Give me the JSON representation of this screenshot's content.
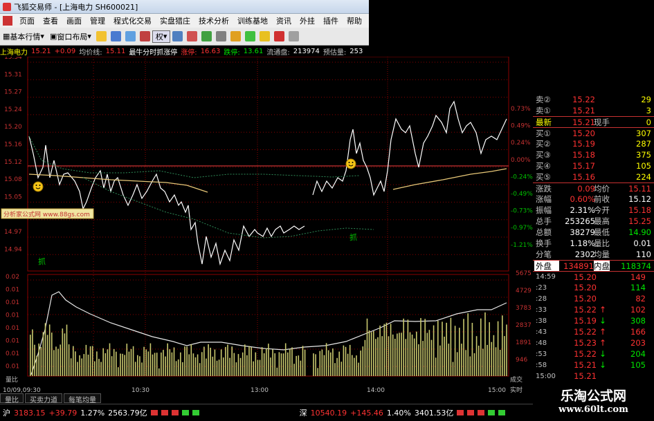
{
  "window": {
    "title": "飞狐交易师 - [上海电力 SH600021]"
  },
  "menu": [
    "页面",
    "查看",
    "画面",
    "管理",
    "程式化交易",
    "实盘猎庄",
    "技术分析",
    "训练基地",
    "资讯",
    "外挂",
    "插件",
    "帮助"
  ],
  "toolbar": {
    "basic": "基本行情",
    "layout": "窗口布局",
    "rights": "权"
  },
  "info": {
    "name": "上海电力",
    "price": "15.21",
    "change": "+0.09",
    "avg_label": "均价线:",
    "avg": "15.11",
    "indicator": "最牛分时抓涨停",
    "zt_label": "涨停:",
    "zt": "16.63",
    "dt_label": "跌停:",
    "dt": "13.61",
    "float_label": "流通盘:",
    "float": "213974",
    "est_label": "预估量:",
    "est": "253"
  },
  "axis": {
    "price_ticks": [
      "15.34",
      "15.31",
      "15.27",
      "15.24",
      "15.20",
      "15.16",
      "15.12",
      "15.08",
      "15.05",
      "15.01",
      "14.97",
      "14.94"
    ],
    "pct_ticks": [
      "0.73%",
      "0.49%",
      "0.24%",
      "0.00%",
      "-0.24%",
      "-0.49%",
      "-0.73%",
      "-0.97%",
      "-1.21%"
    ],
    "vol_left": [
      "0.02",
      "0.01",
      "0.01",
      "0.01",
      "0.01",
      "0.01",
      "0.01",
      "0.01"
    ],
    "vol_right": [
      "5675",
      "4729",
      "3783",
      "2837",
      "1891",
      "946"
    ],
    "time_ticks": [
      "10/09,09:30",
      "10:30",
      "13:00",
      "14:00",
      "15:00"
    ],
    "vol_label": "量比",
    "turnover_label": "成交",
    "fixed_label": "实时"
  },
  "annotations": {
    "site_label": "分析家公式网 www.88gs.com",
    "zhua1": "抓",
    "zhua2": "抓"
  },
  "quote": {
    "sells": [
      {
        "label": "卖②",
        "price": "15.22",
        "vol": "29"
      },
      {
        "label": "卖①",
        "price": "15.21",
        "vol": "3"
      }
    ],
    "last": {
      "label": "最新",
      "price": "15.21",
      "label2": "现手",
      "vol": "0"
    },
    "buys": [
      {
        "label": "买①",
        "price": "15.20",
        "vol": "307"
      },
      {
        "label": "买②",
        "price": "15.19",
        "vol": "287"
      },
      {
        "label": "买③",
        "price": "15.18",
        "vol": "375"
      },
      {
        "label": "买④",
        "price": "15.17",
        "vol": "105"
      },
      {
        "label": "买⑤",
        "price": "15.16",
        "vol": "224"
      }
    ],
    "stats": [
      {
        "l1": "涨跌",
        "v1": "0.09",
        "c1": "red",
        "l2": "均价",
        "v2": "15.11",
        "c2": "red"
      },
      {
        "l1": "涨幅",
        "v1": "0.60%",
        "c1": "red",
        "l2": "前收",
        "v2": "15.12",
        "c2": "white"
      },
      {
        "l1": "振幅",
        "v1": "2.31%",
        "c1": "white",
        "l2": "今开",
        "v2": "15.18",
        "c2": "red"
      },
      {
        "l1": "总手",
        "v1": "253265",
        "c1": "white",
        "l2": "最高",
        "v2": "15.25",
        "c2": "red"
      },
      {
        "l1": "总额",
        "v1": "38279",
        "c1": "white",
        "l2": "最低",
        "v2": "14.90",
        "c2": "green"
      },
      {
        "l1": "换手",
        "v1": "1.18%",
        "c1": "white",
        "l2": "量比",
        "v2": "0.01",
        "c2": "white"
      },
      {
        "l1": "分笔",
        "v1": "2302",
        "c1": "white",
        "l2": "均量",
        "v2": "110",
        "c2": "white"
      }
    ],
    "outer": {
      "l1": "外盘",
      "v1": "134891",
      "l2": "内盘",
      "v2": "118374"
    }
  },
  "ticks": [
    {
      "t": "14:59",
      "p": "15.20",
      "dir": "",
      "v": "149",
      "pc": "red",
      "vc": "red"
    },
    {
      "t": ":23",
      "p": "15.20",
      "dir": "",
      "v": "114",
      "pc": "red",
      "vc": "green"
    },
    {
      "t": ":28",
      "p": "15.20",
      "dir": "",
      "v": "82",
      "pc": "red",
      "vc": "red"
    },
    {
      "t": ":33",
      "p": "15.22",
      "dir": "up",
      "v": "102",
      "pc": "red",
      "vc": "red"
    },
    {
      "t": ":38",
      "p": "15.19",
      "dir": "down",
      "v": "308",
      "pc": "red",
      "vc": "green"
    },
    {
      "t": ":43",
      "p": "15.22",
      "dir": "up",
      "v": "166",
      "pc": "red",
      "vc": "red"
    },
    {
      "t": ":48",
      "p": "15.23",
      "dir": "up",
      "v": "203",
      "pc": "red",
      "vc": "red"
    },
    {
      "t": ":53",
      "p": "15.22",
      "dir": "down",
      "v": "204",
      "pc": "red",
      "vc": "green"
    },
    {
      "t": ":58",
      "p": "15.21",
      "dir": "down",
      "v": "105",
      "pc": "red",
      "vc": "green"
    },
    {
      "t": "15:00",
      "p": "15.21",
      "dir": "",
      "v": "",
      "pc": "red",
      "vc": "red"
    }
  ],
  "tabs": [
    "量比",
    "买卖力道",
    "每笔均量"
  ],
  "bottom": {
    "sh_label": "沪",
    "sh_index": "3183.15",
    "sh_chg": "+39.79",
    "sh_pct": "1.27%",
    "sh_amt": "2563.79亿",
    "sz_label": "深",
    "sz_index": "10540.19",
    "sz_chg": "+145.46",
    "sz_pct": "1.40%",
    "sz_amt": "3401.53亿"
  },
  "watermark": {
    "line1": "乐淘公式网",
    "line2": "www.60lt.com"
  },
  "colors": {
    "up": "#ff3232",
    "down": "#00e600",
    "price_line": "#ffffff",
    "avg_line": "#e8c878",
    "volume": "#c8c86e",
    "grid": "#8b0000"
  }
}
